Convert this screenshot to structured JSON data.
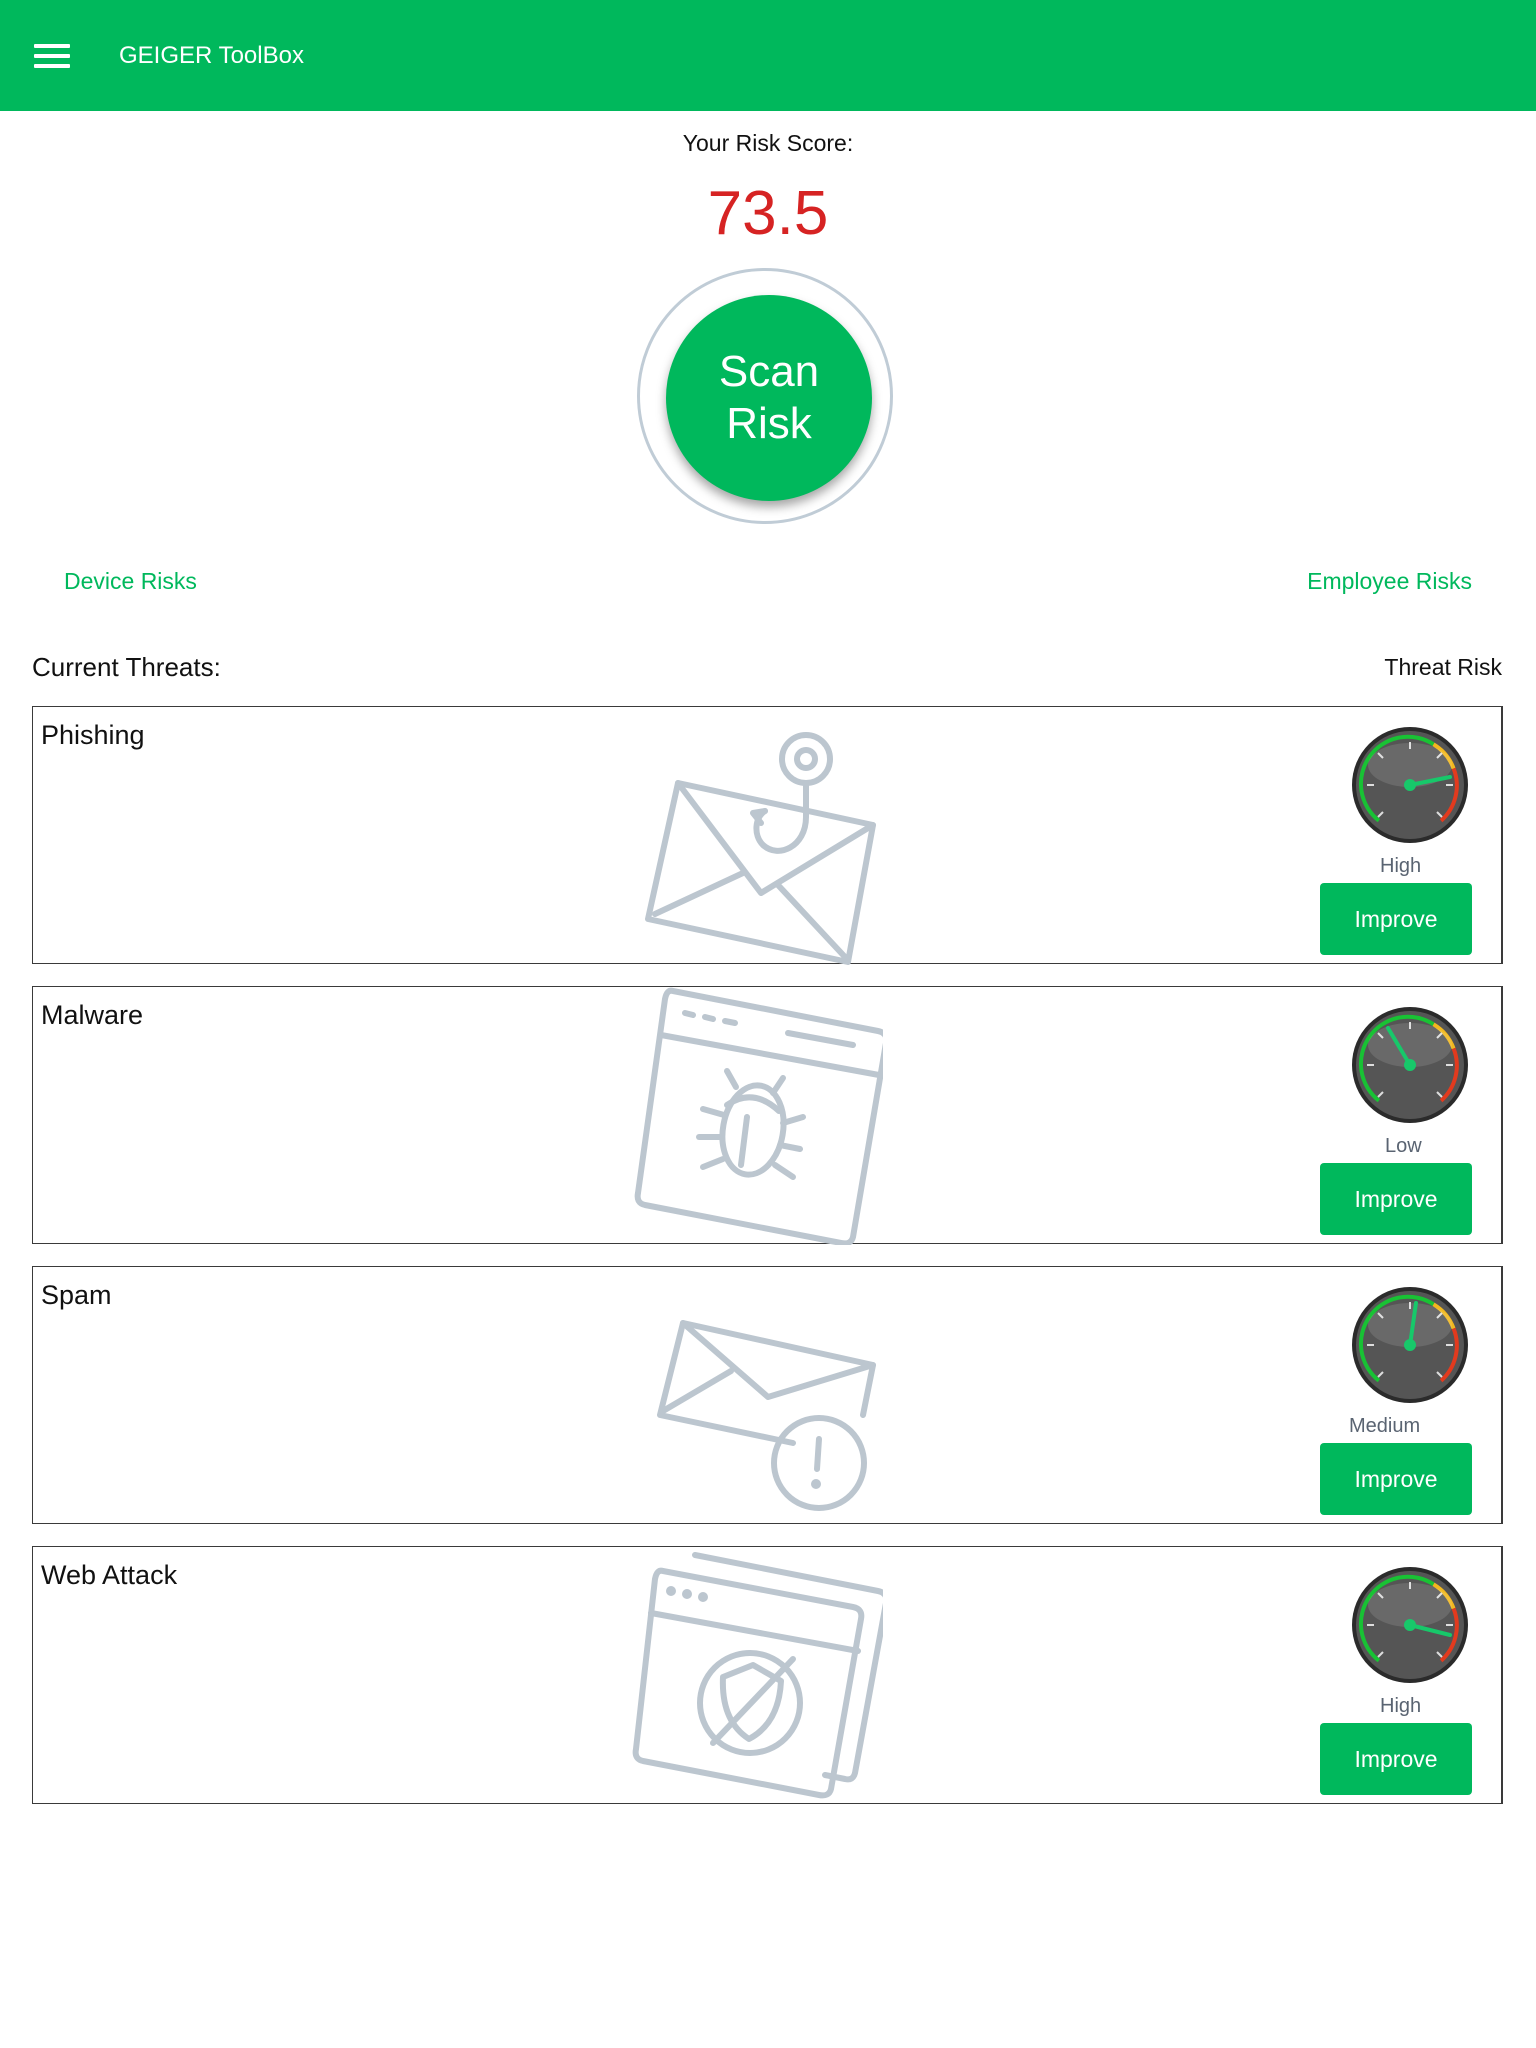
{
  "app_bar": {
    "title": "GEIGER ToolBox",
    "menu_icon": "hamburger-menu-icon",
    "color": "#00b85c"
  },
  "risk": {
    "label": "Your Risk Score:",
    "score": "73.5",
    "score_color": "#d62323"
  },
  "scan_button": {
    "line1": "Scan",
    "line2": "Risk"
  },
  "links": {
    "device": "Device Risks",
    "employee": "Employee Risks"
  },
  "threats": {
    "heading": "Current Threats:",
    "risk_heading": "Threat Risk",
    "items": [
      {
        "title": "Phishing",
        "icon": "phishing-envelope-hook-icon",
        "level": "High",
        "button": "Improve"
      },
      {
        "title": "Malware",
        "icon": "malware-bug-window-icon",
        "level": "Low",
        "button": "Improve"
      },
      {
        "title": "Spam",
        "icon": "spam-envelope-warning-icon",
        "level": "Medium",
        "button": "Improve"
      },
      {
        "title": "Web Attack",
        "icon": "web-attack-shield-window-icon",
        "level": "High",
        "button": "Improve"
      }
    ]
  }
}
